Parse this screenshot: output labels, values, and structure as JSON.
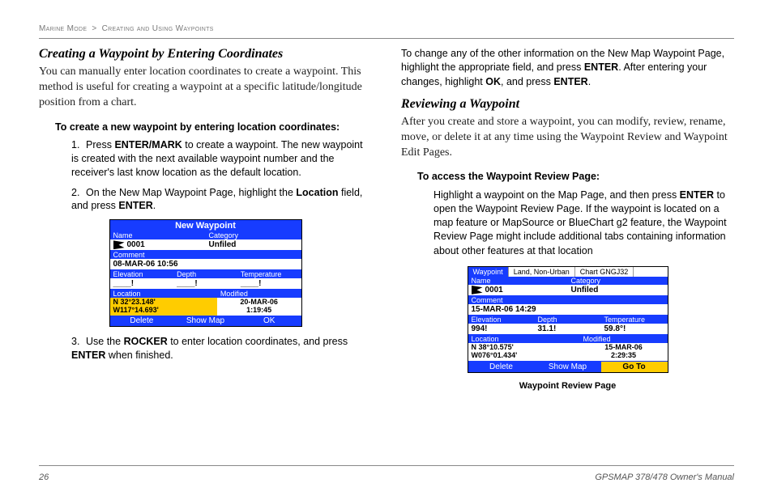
{
  "breadcrumb": {
    "part1": "Marine Mode",
    "sep": ">",
    "part2": "Creating and Using Waypoints"
  },
  "left": {
    "h2": "Creating a Waypoint by Entering Coordinates",
    "intro": "You can manually enter location coordinates to create a waypoint. This method is useful for creating a waypoint at a specific latitude/longitude position from a chart.",
    "subhead": "To create a new waypoint by entering location coordinates:",
    "step1_a": "Press ",
    "step1_b": "ENTER/MARK",
    "step1_c": " to create a waypoint. The new waypoint is created with the next available waypoint number and the receiver's last know location as the default location.",
    "step2_a": "On the New Map Waypoint Page, highlight the ",
    "step2_b": "Location",
    "step2_c": " field, and press ",
    "step2_d": "ENTER",
    "step2_e": ".",
    "step3_a": "Use the ",
    "step3_b": "ROCKER",
    "step3_c": " to enter location coordinates, and press ",
    "step3_d": "ENTER",
    "step3_e": " when finished."
  },
  "shot1": {
    "title": "New Waypoint",
    "lbl_name": "Name",
    "lbl_cat": "Category",
    "name": "0001",
    "cat": "Unfiled",
    "lbl_comment": "Comment",
    "comment": "08-MAR-06 10:56",
    "lbl_elev": "Elevation",
    "lbl_depth": "Depth",
    "lbl_temp": "Temperature",
    "elev": "____!",
    "depth": "____!",
    "temp": "____!",
    "lbl_loc": "Location",
    "lbl_mod": "Modified",
    "loc1": "N  32°23.148'",
    "loc2": "W117°14.693'",
    "mod1": "20-MAR-06",
    "mod2": "1:19:45",
    "btn_del": "Delete",
    "btn_map": "Show Map",
    "btn_ok": "OK"
  },
  "right": {
    "top_a": "To change any of the other information on the New Map Waypoint Page, highlight the appropriate field, and press ",
    "top_b": "ENTER",
    "top_c": ". After entering your changes, highlight ",
    "top_d": "OK",
    "top_e": ", and press ",
    "top_f": "ENTER",
    "top_g": ".",
    "h2": "Reviewing a Waypoint",
    "intro": "After you create and store a waypoint, you can modify, review, rename, move, or delete it at any time using the Waypoint Review and Waypoint Edit Pages.",
    "subhead": "To access the Waypoint Review Page:",
    "para_a": "Highlight a waypoint on the Map Page, and then press ",
    "para_b": "ENTER",
    "para_c": " to open the Waypoint Review Page. If the waypoint is located on a map feature or MapSource or BlueChart g2 feature, the Waypoint Review Page might include additional tabs containing information about other features at that location"
  },
  "shot2": {
    "tab1": "Waypoint",
    "tab2": "Land, Non-Urban",
    "tab3": "Chart GNGJ32",
    "lbl_name": "Name",
    "lbl_cat": "Category",
    "name": "0001",
    "cat": "Unfiled",
    "lbl_comment": "Comment",
    "comment": "15-MAR-06 14:29",
    "lbl_elev": "Elevation",
    "lbl_depth": "Depth",
    "lbl_temp": "Temperature",
    "elev": "994!",
    "depth": "31.1!",
    "temp": "59.8°!",
    "lbl_loc": "Location",
    "lbl_mod": "Modified",
    "loc1": "N 38°10.575'",
    "loc2": "W076°01.434'",
    "mod1": "15-MAR-06",
    "mod2": "2:29:35",
    "btn_del": "Delete",
    "btn_map": "Show Map",
    "btn_go": "Go To",
    "caption": "Waypoint Review Page"
  },
  "footer": {
    "pagenum": "26",
    "manual": "GPSMAP 378/478 Owner's Manual"
  }
}
